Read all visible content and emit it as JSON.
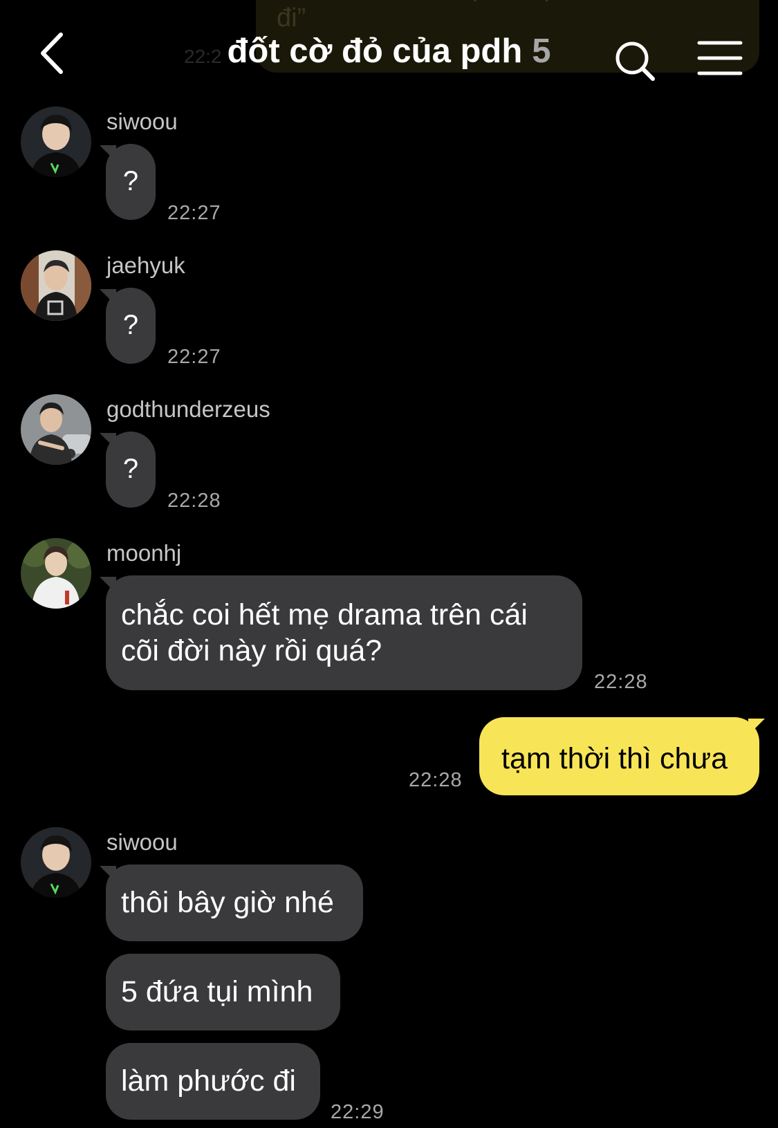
{
  "header": {
    "title": "đốt cờ đỏ của pdh",
    "member_count": "5",
    "back_icon": "chevron-left-icon",
    "search_icon": "search-icon",
    "menu_icon": "hamburger-menu-icon"
  },
  "background_message": {
    "text": "khi cái dưới nhỏ phiền phức rồi\nđi”",
    "time": "22:2"
  },
  "messages": [
    {
      "sender": "siwoou",
      "text": "?",
      "time": "22:27"
    },
    {
      "sender": "jaehyuk",
      "text": "?",
      "time": "22:27"
    },
    {
      "sender": "godthunderzeus",
      "text": "?",
      "time": "22:28"
    },
    {
      "sender": "moonhj",
      "line1": "chắc coi hết mẹ drama trên cái",
      "line2": "cõi đời này rồi quá?",
      "time": "22:28"
    },
    {
      "sender": "me",
      "text": "tạm thời thì chưa",
      "time": "22:28"
    },
    {
      "sender": "siwoou",
      "texts": [
        "thôi bây giờ nhé",
        "5 đứa tụi mình",
        "làm phước đi"
      ],
      "time": "22:29"
    }
  ],
  "colors": {
    "background": "#000000",
    "incoming_bubble": "#3a3a3c",
    "outgoing_bubble": "#f8e557",
    "timestamp": "#a9a9a9"
  }
}
